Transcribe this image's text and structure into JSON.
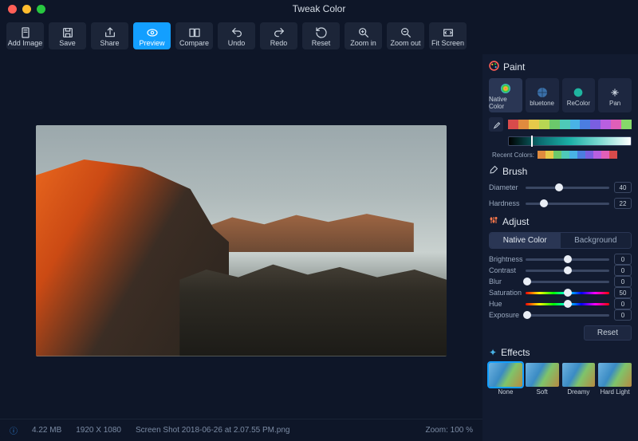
{
  "app_title": "Tweak Color",
  "toolbar": [
    {
      "id": "add-image",
      "label": "Add Image",
      "icon": "page"
    },
    {
      "id": "save",
      "label": "Save",
      "icon": "save"
    },
    {
      "id": "share",
      "label": "Share",
      "icon": "share"
    },
    {
      "id": "preview",
      "label": "Preview",
      "icon": "eye",
      "active": true
    },
    {
      "id": "compare",
      "label": "Compare",
      "icon": "compare"
    },
    {
      "id": "undo",
      "label": "Undo",
      "icon": "undo"
    },
    {
      "id": "redo",
      "label": "Redo",
      "icon": "redo"
    },
    {
      "id": "reset",
      "label": "Reset",
      "icon": "reset"
    },
    {
      "id": "zoom-in",
      "label": "Zoom in",
      "icon": "zoomin"
    },
    {
      "id": "zoom-out",
      "label": "Zoom out",
      "icon": "zoomout"
    },
    {
      "id": "fit-screen",
      "label": "Fit Screen",
      "icon": "fit"
    }
  ],
  "status": {
    "filesize": "4.22 MB",
    "dimensions": "1920 X 1080",
    "filename": "Screen Shot 2018-06-26 at 2.07.55 PM.png",
    "zoom": "Zoom: 100 %"
  },
  "paint": {
    "title": "Paint",
    "tabs": [
      {
        "id": "native-color",
        "label": "Native Color",
        "active": true
      },
      {
        "id": "bluetone",
        "label": "bluetone"
      },
      {
        "id": "recolor",
        "label": "ReColor"
      },
      {
        "id": "pan",
        "label": "Pan"
      }
    ],
    "swatches": [
      "#d84b4b",
      "#e08b3e",
      "#e6c94a",
      "#b7d653",
      "#6bc96b",
      "#4ecab8",
      "#49b3e6",
      "#4b7de0",
      "#7a5fe0",
      "#b85fe0",
      "#e05fb8",
      "#86d96a"
    ],
    "recent_label": "Recent Colors:",
    "recent": [
      "#e08b3e",
      "#e6c94a",
      "#6bc96b",
      "#4ecab8",
      "#49b3e6",
      "#4b7de0",
      "#7a5fe0",
      "#b85fe0",
      "#e05fb8",
      "#d84b4b"
    ]
  },
  "brush": {
    "title": "Brush",
    "diameter_label": "Diameter",
    "diameter_value": "40",
    "diameter_pct": 40,
    "hardness_label": "Hardness",
    "hardness_value": "22",
    "hardness_pct": 22
  },
  "adjust": {
    "title": "Adjust",
    "seg_native": "Native Color",
    "seg_background": "Background",
    "sliders": [
      {
        "id": "brightness",
        "label": "Brightness",
        "value": "0",
        "pct": 50
      },
      {
        "id": "contrast",
        "label": "Contrast",
        "value": "0",
        "pct": 50
      },
      {
        "id": "blur",
        "label": "Blur",
        "value": "0",
        "pct": 2
      },
      {
        "id": "saturation",
        "label": "Saturation",
        "value": "50",
        "pct": 50,
        "cls": "sat-track"
      },
      {
        "id": "hue",
        "label": "Hue",
        "value": "0",
        "pct": 50,
        "cls": "hue-track"
      },
      {
        "id": "exposure",
        "label": "Exposure",
        "value": "0",
        "pct": 2
      }
    ],
    "reset_label": "Reset"
  },
  "effects": {
    "title": "Effects",
    "items": [
      {
        "id": "none",
        "label": "None",
        "active": true
      },
      {
        "id": "soft",
        "label": "Soft"
      },
      {
        "id": "dreamy",
        "label": "Dreamy"
      },
      {
        "id": "hard-light",
        "label": "Hard Light"
      }
    ]
  }
}
